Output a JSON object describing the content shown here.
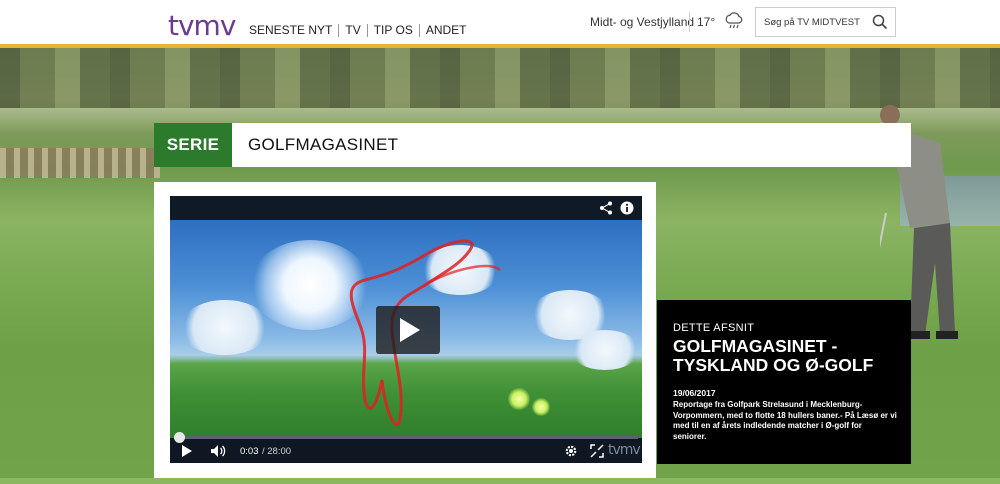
{
  "header": {
    "logo": "tvmv",
    "nav": [
      "SENESTE NYT",
      "TV",
      "TIP OS",
      "ANDET"
    ],
    "region": "Midt- og Vestjylland",
    "temperature": "17°",
    "weather_icon": "rain-cloud-icon",
    "search_placeholder": "Søg på TV MIDTVEST",
    "accent": "#e4b632"
  },
  "series": {
    "tag": "SERIE",
    "title": "GOLFMAGASINET",
    "tag_color": "#2c7a2c"
  },
  "player": {
    "current_time": "0:03",
    "total_time": "/ 28:00",
    "watermark": "tvmv",
    "progress_fraction": 0.002
  },
  "episode": {
    "label": "DETTE AFSNIT",
    "title": "GOLFMAGASINET - TYSKLAND OG Ø-GOLF",
    "date": "19/06/2017",
    "description": "Reportage fra Golfpark Strelasund i Mecklenburg-Vorpommern, med to flotte 18 hullers baner.- På Læsø er vi med til en af årets indledende matcher i Ø-golf for seniorer."
  }
}
